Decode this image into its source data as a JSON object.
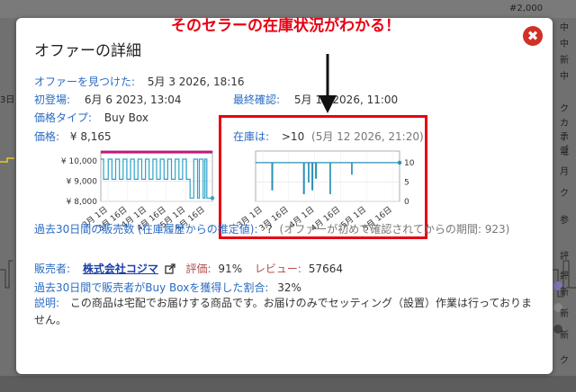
{
  "background": {
    "top_price": "#2,000",
    "left_marker": "3日",
    "right_items": [
      "中",
      "中",
      "新",
      "中",
      "ク",
      "カテゴ",
      "ホ",
      "電",
      "月",
      "ク",
      "参",
      "評",
      "評",
      "新",
      "新",
      "新",
      "ク"
    ]
  },
  "annotation": {
    "text": "そのセラーの在庫状況がわかる！"
  },
  "dialog": {
    "title": "オファーの詳細",
    "close_icon": "✖",
    "offer_found": {
      "label": "オファーを見つけた:",
      "value": "5月 3 2026, 18:16"
    },
    "first_seen": {
      "label": "初登場:",
      "value": "6月 6 2023, 13:04"
    },
    "last_seen": {
      "label": "最終確認:",
      "value": "5月 12 2026, 11:00"
    },
    "price_type": {
      "label": "価格タイプ:",
      "value": "Buy Box"
    },
    "price": {
      "label": "価格:",
      "value": "¥ 8,165"
    },
    "stock": {
      "label": "在庫は:",
      "value": ">10",
      "date": "(5月 12 2026, 21:20)"
    },
    "sales": {
      "label": "過去30日間の販売数 (在庫履歴からの推定値):",
      "value": "?",
      "note": "(オファーが初めて確認されてからの期間: 923)"
    },
    "seller": {
      "label": "販売者:",
      "name": "株式会社コジマ",
      "rating_label": "評価:",
      "rating": "91%",
      "review_label": "レビュー:",
      "reviews": "57664"
    },
    "buybox": {
      "label": "過去30日間で販売者がBuy Boxを獲得した割合:",
      "value": "32%"
    },
    "description": {
      "label": "説明:",
      "text": "この商品は宅配でお届けする商品です。お届けのみでセッティング（設置）作業は行っておりません。"
    }
  },
  "chart_data": [
    {
      "type": "line",
      "x_ticks": [
        "3月 1日",
        "3月 16日",
        "4月 1日",
        "4月 16日",
        "5月 1日",
        "5月 16日"
      ],
      "y_ticks": [
        "¥ 10,000",
        "¥ 9,000",
        "¥ 8,000"
      ],
      "ylim": [
        8000,
        10500
      ],
      "series": [
        {
          "color": "#c2187a",
          "x": [
            0,
            60
          ],
          "y": [
            10450,
            10450
          ]
        },
        {
          "color": "#2fa3c7",
          "x": [
            0,
            1.5,
            1.5,
            4,
            4,
            6,
            6,
            8,
            8,
            10,
            10,
            12,
            12,
            14,
            14,
            16,
            16,
            18,
            18,
            20,
            20,
            22,
            22,
            24,
            24,
            26,
            26,
            28,
            28,
            30,
            30,
            32,
            32,
            34,
            34,
            36,
            36,
            38,
            38,
            40,
            40,
            42,
            42,
            44,
            44,
            46,
            46,
            48,
            48,
            50,
            50,
            52,
            52,
            53,
            53,
            55,
            55,
            56,
            56,
            57,
            57,
            58,
            58,
            59,
            59,
            60
          ],
          "y": [
            10100,
            10100,
            9100,
            9100,
            10100,
            10100,
            9100,
            9100,
            10100,
            10100,
            9100,
            9100,
            10100,
            10100,
            9100,
            9100,
            10100,
            10100,
            9100,
            9100,
            10100,
            10100,
            9100,
            9100,
            10100,
            10100,
            9100,
            9100,
            10100,
            10100,
            9100,
            9100,
            10100,
            10100,
            9100,
            9100,
            10100,
            10100,
            9100,
            9100,
            10100,
            10100,
            9100,
            9100,
            10100,
            10100,
            9100,
            9100,
            8165,
            8165,
            10100,
            10100,
            8165,
            8165,
            10100,
            10100,
            8165,
            8165,
            10100,
            10100,
            8165,
            8165,
            8165,
            8165,
            8165,
            8165
          ]
        }
      ]
    },
    {
      "type": "line",
      "x_ticks": [
        "3月 1日",
        "3月 16日",
        "4月 1日",
        "4月 16日",
        "5月 1日",
        "5月 16日"
      ],
      "y_ticks": [
        "10",
        "5",
        "0"
      ],
      "ylim": [
        0,
        13
      ],
      "series": [
        {
          "color": "#2a8fb6",
          "x": [
            0,
            6.8,
            6.8,
            7.1,
            7.1,
            20,
            20,
            20.3,
            20.3,
            22,
            22,
            22.2,
            22.2,
            23.5,
            23.5,
            23.8,
            23.8,
            25,
            25,
            25.3,
            25.3,
            31,
            31,
            31.2,
            31.2,
            40,
            40,
            40.2,
            40.2,
            60
          ],
          "y": [
            10,
            10,
            3,
            3,
            10,
            10,
            2,
            2,
            10,
            10,
            5,
            5,
            10,
            10,
            3,
            3,
            10,
            10,
            6,
            6,
            10,
            10,
            2,
            2,
            10,
            10,
            7,
            7,
            10,
            10
          ]
        }
      ]
    }
  ]
}
